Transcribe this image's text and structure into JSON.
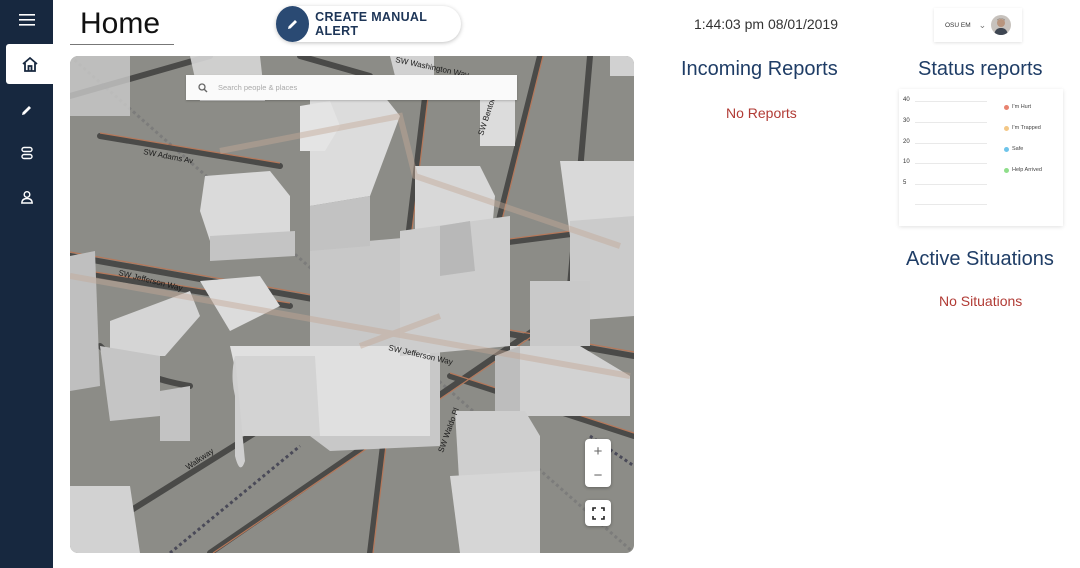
{
  "sidebar": {
    "items": [
      {
        "name": "menu",
        "icon": "hamburger-menu-icon"
      },
      {
        "name": "home",
        "icon": "home-icon"
      },
      {
        "name": "edit",
        "icon": "pencil-icon"
      },
      {
        "name": "situations",
        "icon": "stack-icon"
      },
      {
        "name": "profile",
        "icon": "user-icon"
      }
    ]
  },
  "header": {
    "title": "Home",
    "alert_button": {
      "label": "CREATE MANUAL ALERT",
      "icon": "pencil-icon"
    },
    "clock": "1:44:03 pm 08/01/2019",
    "user": {
      "name": "OSU EM",
      "avatar": "avatar"
    }
  },
  "map": {
    "search_placeholder": "Search people & places",
    "labels": {
      "jefferson_1": "SW Jefferson Way",
      "jefferson_2": "SW Jefferson Way",
      "washington": "SW Washington Way",
      "adams": "SW Adams Av",
      "waldo": "SW Waldo Pl",
      "walkway": "Walkway",
      "benton": "SW Benton Pl"
    },
    "zoom_in": "+",
    "zoom_out": "−"
  },
  "incoming_reports": {
    "title": "Incoming Reports",
    "empty": "No Reports"
  },
  "status_reports": {
    "title": "Status reports",
    "y_ticks": [
      "40",
      "30",
      "20",
      "10",
      "5"
    ],
    "legend": [
      {
        "label": "I'm Hurt",
        "color": "#e8836f"
      },
      {
        "label": "I'm Trapped",
        "color": "#f3c786"
      },
      {
        "label": "Safe",
        "color": "#6ec4ea"
      },
      {
        "label": "Help Arrived",
        "color": "#8fde8a"
      }
    ]
  },
  "active_situations": {
    "title": "Active Situations",
    "empty": "No Situations"
  },
  "colors": {
    "sidebar": "#17283f",
    "accent": "#1f3d66",
    "alert": "#b13b35"
  }
}
